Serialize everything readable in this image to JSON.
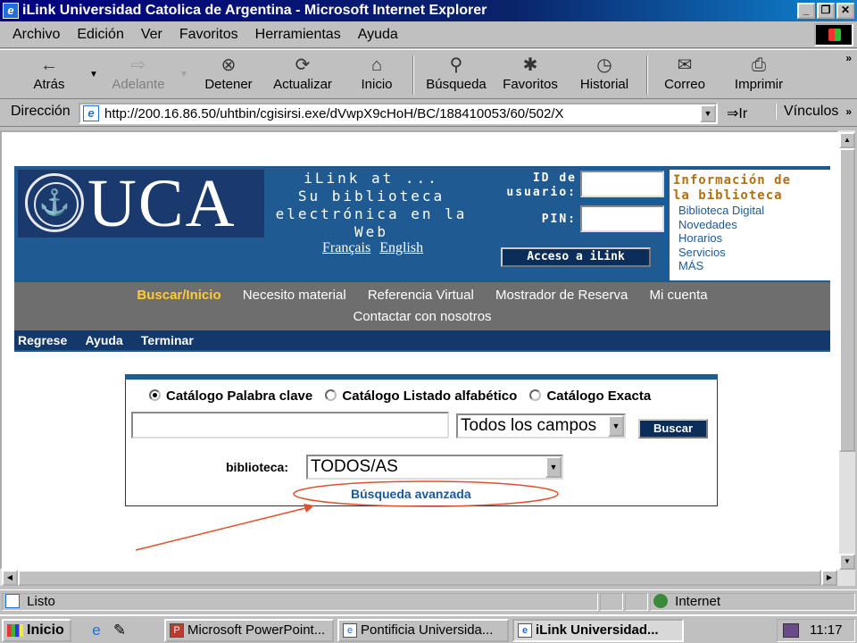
{
  "window": {
    "title": "iLink Universidad Catolica de Argentina - Microsoft Internet Explorer",
    "app_icon": "e"
  },
  "menu": {
    "items": [
      "Archivo",
      "Edición",
      "Ver",
      "Favoritos",
      "Herramientas",
      "Ayuda"
    ]
  },
  "toolbar": {
    "back": {
      "label": "Atrás",
      "icon": "←"
    },
    "forward": {
      "label": "Adelante",
      "icon": "⇨"
    },
    "stop": {
      "label": "Detener",
      "icon": "⊗"
    },
    "refresh": {
      "label": "Actualizar",
      "icon": "⟳"
    },
    "home": {
      "label": "Inicio",
      "icon": "⌂"
    },
    "search": {
      "label": "Búsqueda",
      "icon": "⚲"
    },
    "favorites": {
      "label": "Favoritos",
      "icon": "✱"
    },
    "history": {
      "label": "Historial",
      "icon": "◷"
    },
    "mail": {
      "label": "Correo",
      "icon": "✉"
    },
    "print": {
      "label": "Imprimir",
      "icon": "⎙"
    },
    "chevron": "»"
  },
  "address": {
    "label": "Dirección",
    "url": "http://200.16.86.50/uhtbin/cgisirsi.exe/dVwpX9cHoH/BC/188410053/60/502/X",
    "go_label": "Ir",
    "links_label": "Vínculos",
    "links_chevron": "»"
  },
  "page": {
    "logo_text": "UCA",
    "title_lines": [
      "iLink at ...",
      "Su biblioteca",
      "electrónica en la",
      "Web"
    ],
    "lang_links": [
      "Français",
      "English"
    ],
    "user_id_label_1": "ID de",
    "user_id_label_2": "usuario:",
    "pin_label": "PIN:",
    "login_button": "Acceso a iLink",
    "info_title_1": "Información de",
    "info_title_2": "la biblioteca",
    "info_links": [
      "Biblioteca Digital",
      "Novedades",
      "Horarios",
      "Servicios",
      "MÁS"
    ],
    "nav_row1": [
      "Buscar/Inicio",
      "Necesito material",
      "Referencia Virtual",
      "Mostrador de Reserva",
      "Mi cuenta"
    ],
    "nav_row2": [
      "Contactar con nosotros"
    ],
    "subnav": [
      "Regrese",
      "Ayuda",
      "Terminar"
    ],
    "search": {
      "radio_options": [
        "Catálogo Palabra clave",
        "Catálogo Listado alfabético",
        "Catálogo Exacta"
      ],
      "selected_radio": 0,
      "query_value": "",
      "field_select": "Todos los campos",
      "search_button": "Buscar",
      "library_label": "biblioteca:",
      "library_select": "TODOS/AS",
      "advanced_link": "Búsqueda avanzada"
    },
    "annotation_color": "#e05030",
    "header_bg": "#1f5a93",
    "nav_bg": "#6e6e6e"
  },
  "status": {
    "text": "Listo",
    "zone": "Internet"
  },
  "taskbar": {
    "start": "Inicio",
    "tasks": [
      "Microsoft PowerPoint...",
      "Pontificia Universida...",
      "iLink Universidad..."
    ],
    "clock": "11:17"
  }
}
